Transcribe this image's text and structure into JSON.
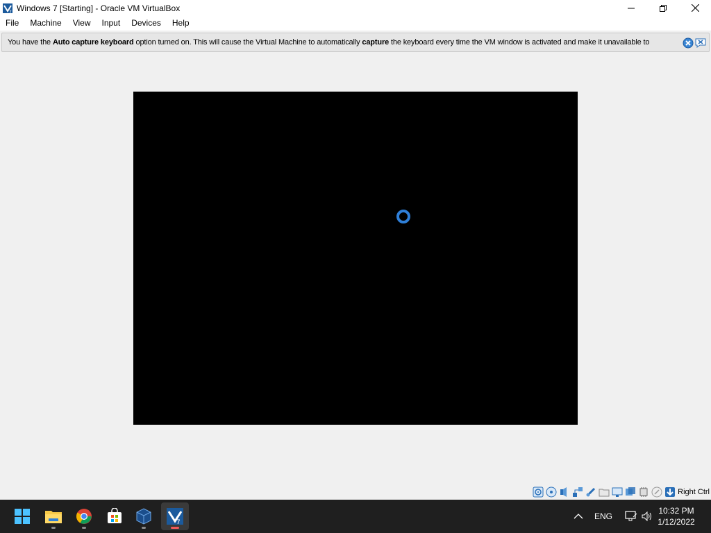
{
  "window": {
    "title": "Windows 7 [Starting] - Oracle VM VirtualBox",
    "controls": [
      "minimize-icon",
      "maximize-icon",
      "close-icon"
    ]
  },
  "menu": {
    "items": [
      "File",
      "Machine",
      "View",
      "Input",
      "Devices",
      "Help"
    ]
  },
  "notice": {
    "part1": "You have the ",
    "bold1": "Auto capture keyboard",
    "part2": " option turned on. This will cause the Virtual Machine to automatically ",
    "bold2": "capture",
    "part3": " the keyboard every time the VM window is activated and make it unavailable to",
    "buttons": [
      "close-message-icon",
      "dont-show-again-icon"
    ]
  },
  "vm": {
    "state": "starting",
    "screen_color": "#000000",
    "spinner_color": "#2f7fd8"
  },
  "statusbar": {
    "icons": [
      "hard-disk-icon",
      "optical-drive-icon",
      "audio-icon",
      "network-icon",
      "usb-icon",
      "shared-folders-icon",
      "display-icon",
      "video-capture-icon",
      "cpu-icon",
      "mouse-integration-icon",
      "keyboard-capture-icon"
    ],
    "host_key": "Right Ctrl"
  },
  "taskbar": {
    "apps": [
      "start-icon",
      "file-explorer-icon",
      "chrome-icon",
      "store-icon",
      "virtualbox-icon",
      "vm-window-icon"
    ],
    "tray": {
      "lang": "ENG",
      "time": "10:32 PM",
      "date": "1/12/2022"
    }
  }
}
